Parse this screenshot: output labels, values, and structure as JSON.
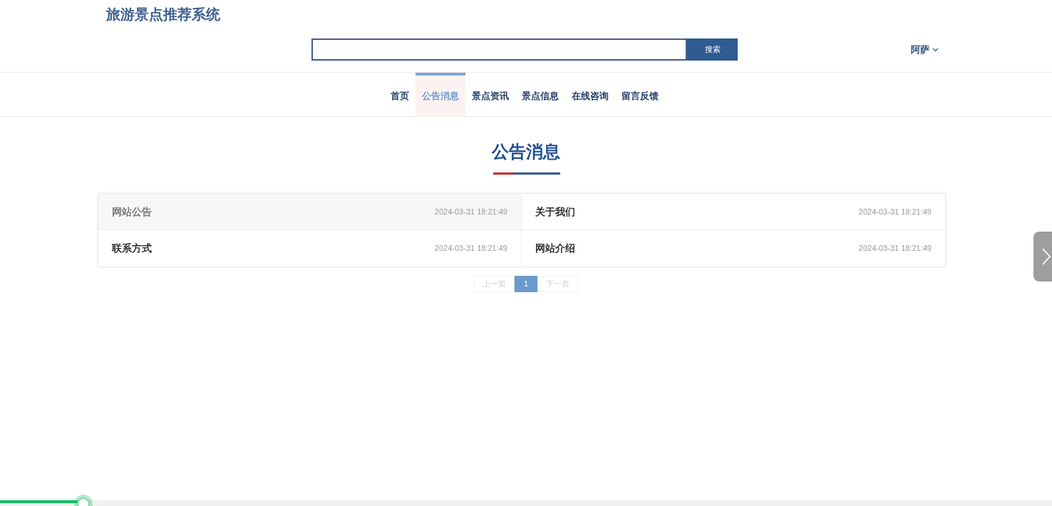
{
  "site_title": "旅游景点推荐系统",
  "search": {
    "button": "搜索"
  },
  "user": {
    "name": "阿萨"
  },
  "nav": [
    {
      "label": "首页",
      "selected": false
    },
    {
      "label": "公告消息",
      "selected": true
    },
    {
      "label": "景点资讯",
      "selected": false
    },
    {
      "label": "景点信息",
      "selected": false
    },
    {
      "label": "在线咨询",
      "selected": false
    },
    {
      "label": "留言反馈",
      "selected": false
    }
  ],
  "heading": "公告消息",
  "notices": [
    {
      "title": "网站公告",
      "time": "2024-03-31 18:21:49",
      "highlighted": true
    },
    {
      "title": "关于我们",
      "time": "2024-03-31 18:21:49",
      "highlighted": false
    },
    {
      "title": "联系方式",
      "time": "2024-03-31 18:21:49",
      "highlighted": false
    },
    {
      "title": "网站介绍",
      "time": "2024-03-31 18:21:49",
      "highlighted": false
    }
  ],
  "pagination": {
    "prev": {
      "label": "上一页",
      "disabled": true
    },
    "pages": [
      {
        "label": "1",
        "selected": true
      }
    ],
    "next": {
      "label": "下一页",
      "disabled": true
    }
  },
  "playback": {
    "level": 0.079
  }
}
